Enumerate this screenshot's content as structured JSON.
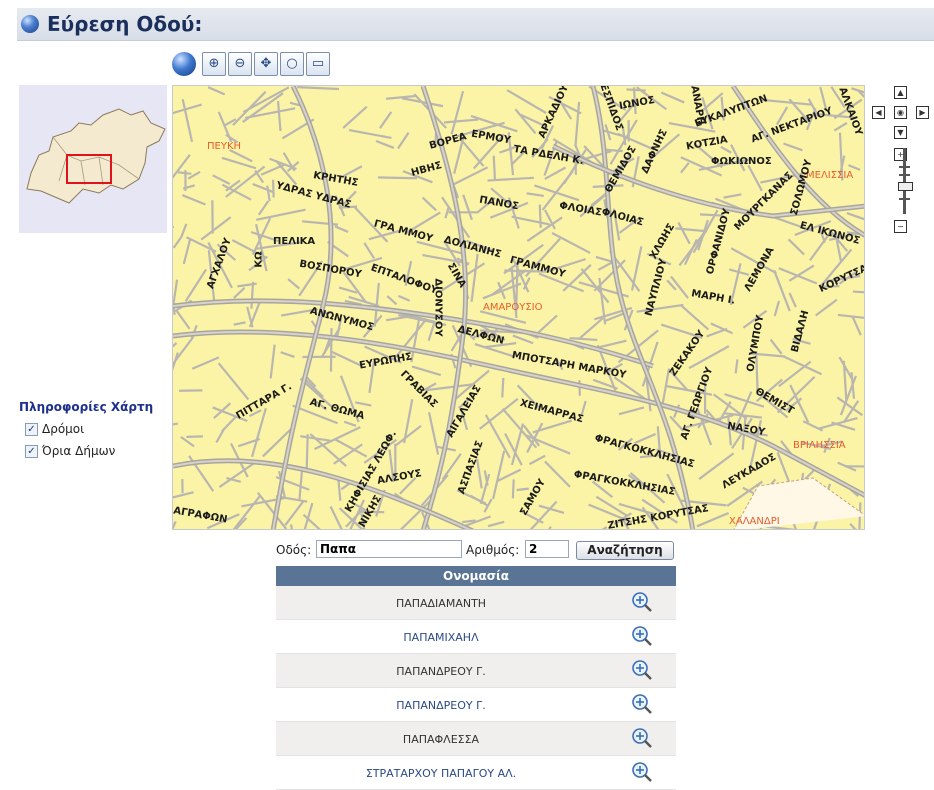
{
  "header": {
    "title": "Εύρεση Οδού:"
  },
  "toolbar": {
    "buttons": [
      "globe-icon",
      "zoom-in-icon",
      "zoom-out-icon",
      "pan-icon",
      "magnifier-icon",
      "measure-icon"
    ]
  },
  "map": {
    "municipalities": [
      "ΠΕΥΚΗ",
      "ΜΕΛΙΣΣΙΑ",
      "ΑΜΑΡΟΥΣΙΟ",
      "ΒΡΙΛΗΣΣΙΑ",
      "ΧΑΛΑΝΔΡΙ"
    ],
    "streets": [
      "ΙΩΝΟΣ",
      "ΘΕΣΠΙΔΟΣ",
      "ΑΡΚΑΔΙΟΥ",
      "ΚΑΝΑΡΗ",
      "ΕΥΚΑΛΥΠΤΩΝ",
      "ΑΓ. ΝΕΚΤΑΡΙΟΥ",
      "ΑΛΚΑΙΟΥ",
      "ΒΟΡΕΑ",
      "ΕΡΜΟΥ",
      "ΤΑ ΡΔΕΛΗ Κ.",
      "ΚΟΤΖΙΑ",
      "ΦΩΚΙΩΝΟΣ",
      "ΔΑΦΝΗΣ",
      "ΘΕΜΙΔΟΣ",
      "ΚΡΗΤΗΣ",
      "ΗΒΗΣ",
      "ΥΔΡΑΣ ΥΔΡΑΣ",
      "ΠΑΝΟΣ",
      "ΦΛΟΙΑΣ",
      "ΦΛΟΙΑΣ",
      "ΜΟΥΡΓΚΑΝΑΣ",
      "ΣΟΛΩΜΟΥ",
      "ΠΕΛΙΚΑ",
      "ΓΡΑ ΜΜΟΥ",
      "ΔΟΛΙΑΝΗΣ",
      "ΓΡΑΜΜΟΥ",
      "ΧΛΩΗΣ",
      "ΟΡΦΑΝΙΔΟΥ",
      "ΕΛ ΙΚΩΝΟΣ",
      "ΒΟΣΠΟΡΟΥ",
      "ΕΠΤΑΛΟΦΟΥ",
      "ΣΙΝΑ",
      "ΛΕΜΟΝΑ",
      "ΚΟΡΥΤΣΑΣ",
      "ΝΑΥΠΛΙΟΥ",
      "ΜΑΡΗ Ι.",
      "ΑΝΩΝΥΜΟΣ",
      "ΔΙΟΝΥΣΟΥ",
      "ΔΕΛΦΩΝ",
      "ΒΙΔΑΛΗ",
      "ΟΛΥΜΠΟΥ",
      "ΕΥΡΩΠΗΣ",
      "ΜΠΟΤΣΑΡΗ ΜΑΡΚΟΥ",
      "ΖΕΚΑΚΟΥ",
      "ΑΓ. ΓΕΩΡΓΙΟΥ",
      "ΘΕΜΙΣΤ",
      "ΠΙΤΤΑΡΑ Γ.",
      "ΑΓ. ΘΩΜΑ",
      "ΓΡΑΒΙΑΣ",
      "ΑΙΓΑΛΕΙΑΣ",
      "ΧΕΙΜΑΡΡΑΣ",
      "ΝΑΞΟΥ",
      "ΦΡΑΓΚΟΚΚΛΗΣΙΑΣ",
      "ΦΡΑΓΚΟΚΚΛΗΣΙΑΣ",
      "ΛΕΥΚΑΔΟΣ",
      "ΚΗΦΙΣΙΑΣ ΛΕΩΦ.",
      "ΑΛΣΟΥΣ",
      "ΑΣΠΑΣΙΑΣ",
      "ΣΑΜΟΥ",
      "ΑΓΡΑΦΩΝ",
      "ΝΙΚΗΣ",
      "ΖΙΤΣΗΣ ΚΟΡΥΤΣΑΣ",
      "ΑΓΧΑΛΟΥ",
      "ΚΩ"
    ]
  },
  "info": {
    "title": "Πληροφορίες Χάρτη",
    "layers": [
      {
        "label": "Δρόμοι",
        "checked": true
      },
      {
        "label": "Όρια Δήμων",
        "checked": true
      }
    ]
  },
  "search": {
    "street_label": "Οδός:",
    "street_value": "Παπα",
    "number_label": "Αριθμός:",
    "number_value": "2",
    "button_label": "Αναζήτηση"
  },
  "results": {
    "header": "Ονομασία",
    "rows": [
      "ΠΑΠΑΔΙΑΜΑΝΤΗ",
      "ΠΑΠΑΜΙΧΑΗΛ",
      "ΠΑΠΑΝΔΡΕΟΥ Γ.",
      "ΠΑΠΑΝΔΡΕΟΥ Γ.",
      "ΠΑΠΑΦΛΕΣΣΑ",
      "ΣΤΡΑΤΑΡΧΟΥ ΠΑΠΑΓΟΥ ΑΛ."
    ]
  },
  "colors": {
    "map_bg": "#fbf4a6",
    "road": "#b9b6b0",
    "municipality_label": "#e85c2c",
    "table_header": "#5a7495"
  }
}
